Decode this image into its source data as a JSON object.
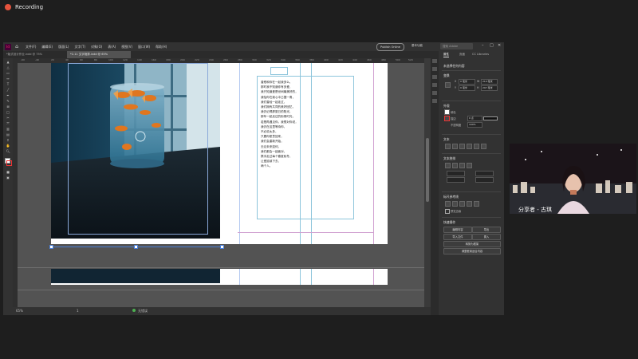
{
  "recording": {
    "label": "Recording"
  },
  "menubar": {
    "items": [
      "文件(F)",
      "编辑(E)",
      "版面(L)",
      "文字(T)",
      "对象(O)",
      "表(A)",
      "视图(V)",
      "窗口(W)",
      "帮助(H)"
    ],
    "publish_label": "Publish Online",
    "workspace_label": "基本功能",
    "search_placeholder": "搜索 Adobe"
  },
  "tabs": [
    {
      "label": "*版式设计作业.indd @ 75%"
    },
    {
      "label": "*2-11 文字绕排.indd @ 65%"
    }
  ],
  "ruler": {
    "ticks": [
      "-60",
      "-40",
      "20",
      "40",
      "60",
      "80",
      "100",
      "120",
      "140",
      "160",
      "180",
      "200",
      "220",
      "240",
      "260",
      "280",
      "300",
      "320",
      "340",
      "360",
      "380",
      "400",
      "420",
      "440",
      "460",
      "480",
      "500",
      "520",
      "540"
    ]
  },
  "document": {
    "text_lines": [
      "曾經和你在一起我多么，",
      "那时我不知道你有多爱，",
      "我只知道爱是世间最美好的，",
      "我恰你在我心中占据一角，",
      "我们曾经一起走过，",
      "我们拥有共同的美好回忆，",
      "我仍记得那夏日的阳光，",
      "那年一起走过的街角时光，",
      "若是再遇见你，我想对你说，",
      "我仍在这里等待你，",
      "不必说太多，",
      "只要你愿意回来，",
      "我们会重新开始，",
      "无论未来如何，",
      "我们都会一起面对，",
      "携手走过每个春夏秋冬，",
      "让爱延续下去，",
      "两个人。"
    ]
  },
  "statusbar": {
    "zoom": "65%",
    "page": "1",
    "status": "无错误"
  },
  "panel": {
    "tabs": [
      "属性",
      "页面",
      "CC Libraries"
    ],
    "title": "未选择任何内容",
    "sections": {
      "transform": "变换",
      "appearance": "外观",
      "text": "文本",
      "paragraph": "段落样式",
      "text_wrap": "文本绕排",
      "guides": "标尺参考线",
      "quick_actions": "快速操作"
    },
    "fields": {
      "x": "X",
      "y": "Y",
      "w": "W",
      "h": "H",
      "x_val": "0 毫米",
      "y_val": "0 毫米",
      "w_val": "210 毫米",
      "h_val": "297 毫米"
    },
    "appearance": {
      "fill": "填色",
      "stroke": "描边",
      "opacity": "不透明度",
      "opacity_val": "100%",
      "stroke_val": "0 点"
    },
    "buttons": {
      "edit_content": "编辑内容",
      "import_file": "导入文件",
      "place": "置入",
      "export": "导出",
      "convert": "转换为框架",
      "adjust": "调整框架适合内容"
    },
    "checkbox_label": "预览边缘"
  },
  "webcam": {
    "name": "分享者 - 古琪"
  },
  "colors": {
    "accent": "#470137",
    "brand": "#ff3366",
    "rec": "#e5533d",
    "water": "#2a6f8f",
    "fish": "#e0761f"
  }
}
